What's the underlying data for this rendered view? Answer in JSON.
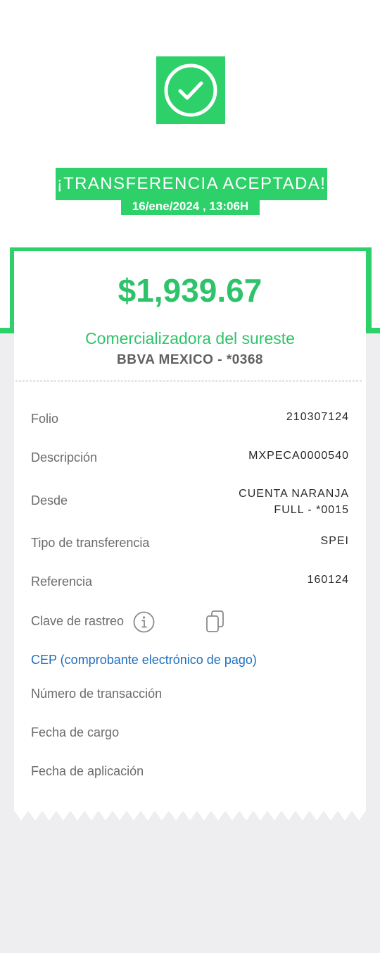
{
  "status": {
    "title": "¡TRANSFERENCIA ACEPTADA!",
    "datetime": "16/ene/2024 , 13:06H"
  },
  "receipt": {
    "amount": "$1,939.67",
    "beneficiary": "Comercializadora del sureste",
    "bank": "BBVA MEXICO - *0368",
    "rows": [
      {
        "label": "Folio",
        "value": "210307124"
      },
      {
        "label": "Descripción",
        "value": "MXPECA0000540"
      },
      {
        "label": "Desde",
        "value_line1": "CUENTA NARANJA",
        "value_line2": "FULL - *0015"
      },
      {
        "label": "Tipo de transferencia",
        "value": "SPEI"
      },
      {
        "label": "Referencia",
        "value": "160124"
      },
      {
        "label": "Clave de rastreo",
        "value": ""
      }
    ],
    "cep_link": "CEP (comprobante electrónico de pago)",
    "extra_rows": [
      {
        "label": "Número de transacción"
      },
      {
        "label": "Fecha de cargo"
      },
      {
        "label": "Fecha de aplicación"
      }
    ]
  },
  "icons": {
    "success": "check-circle-icon",
    "info": "info-icon",
    "copy": "copy-icon"
  },
  "colors": {
    "accent_green": "#2ed06a",
    "amount_green": "#2ec36a",
    "link_blue": "#1e6fbf",
    "background": "#eeeef1"
  }
}
